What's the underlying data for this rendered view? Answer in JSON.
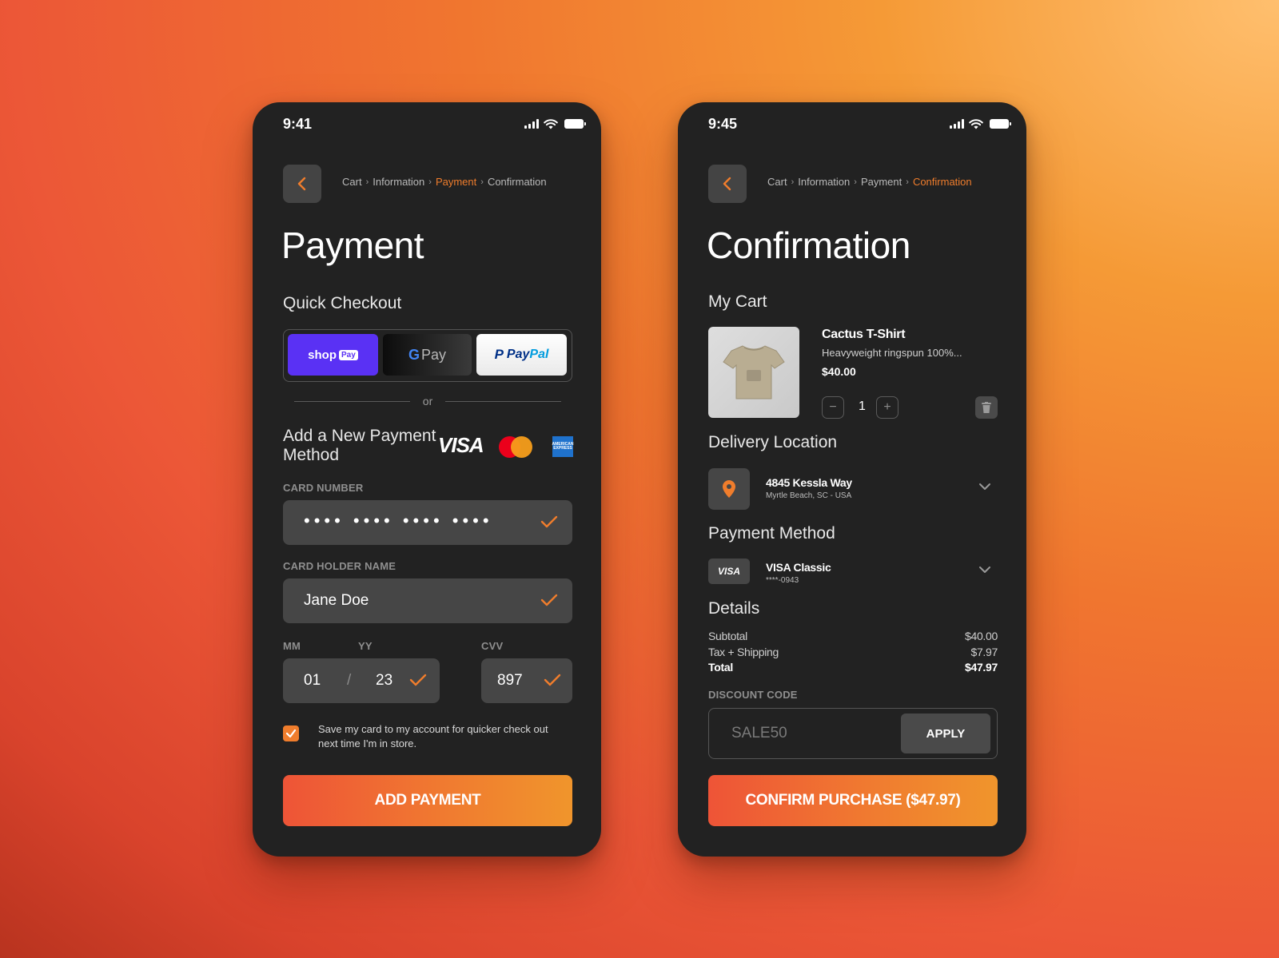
{
  "payment_screen": {
    "status_time": "9:41",
    "breadcrumb": [
      "Cart",
      "Information",
      "Payment",
      "Confirmation"
    ],
    "breadcrumb_active": "Payment",
    "title": "Payment",
    "quick_checkout_title": "Quick Checkout",
    "shop_pay": {
      "word": "shop",
      "badge": "Pay"
    },
    "google_pay": {
      "g": "G",
      "pay": "Pay"
    },
    "paypal": {
      "word1": "Pay",
      "word2": "Pal"
    },
    "or_label": "or",
    "add_method_title": "Add a New Payment Method",
    "visa_label": "VISA",
    "amex_label": "AMERICAN EXPRESS",
    "card_number_label": "CARD NUMBER",
    "card_number_value": "•••• •••• •••• ••••",
    "card_holder_label": "CARD HOLDER NAME",
    "card_holder_value": "Jane Doe",
    "mm_label": "MM",
    "yy_label": "YY",
    "cvv_label": "CVV",
    "mm_value": "01",
    "date_separator": "/",
    "yy_value": "23",
    "cvv_value": "897",
    "save_card_checked": true,
    "save_card_text": "Save my card to my account for quicker check out next time I'm in store.",
    "cta_label": "ADD PAYMENT"
  },
  "confirm_screen": {
    "status_time": "9:45",
    "breadcrumb": [
      "Cart",
      "Information",
      "Payment",
      "Confirmation"
    ],
    "breadcrumb_active": "Confirmation",
    "title": "Confirmation",
    "my_cart_title": "My Cart",
    "product": {
      "name": "Cactus T-Shirt",
      "description": "Heavyweight ringspun 100%...",
      "price": "$40.00",
      "quantity": "1",
      "minus": "−",
      "plus": "+"
    },
    "delivery_title": "Delivery Location",
    "address_line1": "4845 Kessla Way",
    "address_line2": "Myrtle Beach, SC - USA",
    "payment_method_title": "Payment Method",
    "card_brand": "VISA",
    "card_name": "VISA Classic",
    "card_masked": "****-0943",
    "details_title": "Details",
    "details": [
      {
        "label": "Subtotal",
        "value": "$40.00"
      },
      {
        "label": "Tax + Shipping",
        "value": "$7.97"
      },
      {
        "label": "Total",
        "value": "$47.97"
      }
    ],
    "discount_label": "DISCOUNT CODE",
    "discount_value": "SALE50",
    "apply_label": "APPLY",
    "cta_label": "CONFIRM PURCHASE ($47.97)"
  },
  "colors": {
    "accent": "#f07d2c",
    "phone_bg": "#222222",
    "field_bg": "#464646",
    "shop_pay": "#5a31f4"
  }
}
